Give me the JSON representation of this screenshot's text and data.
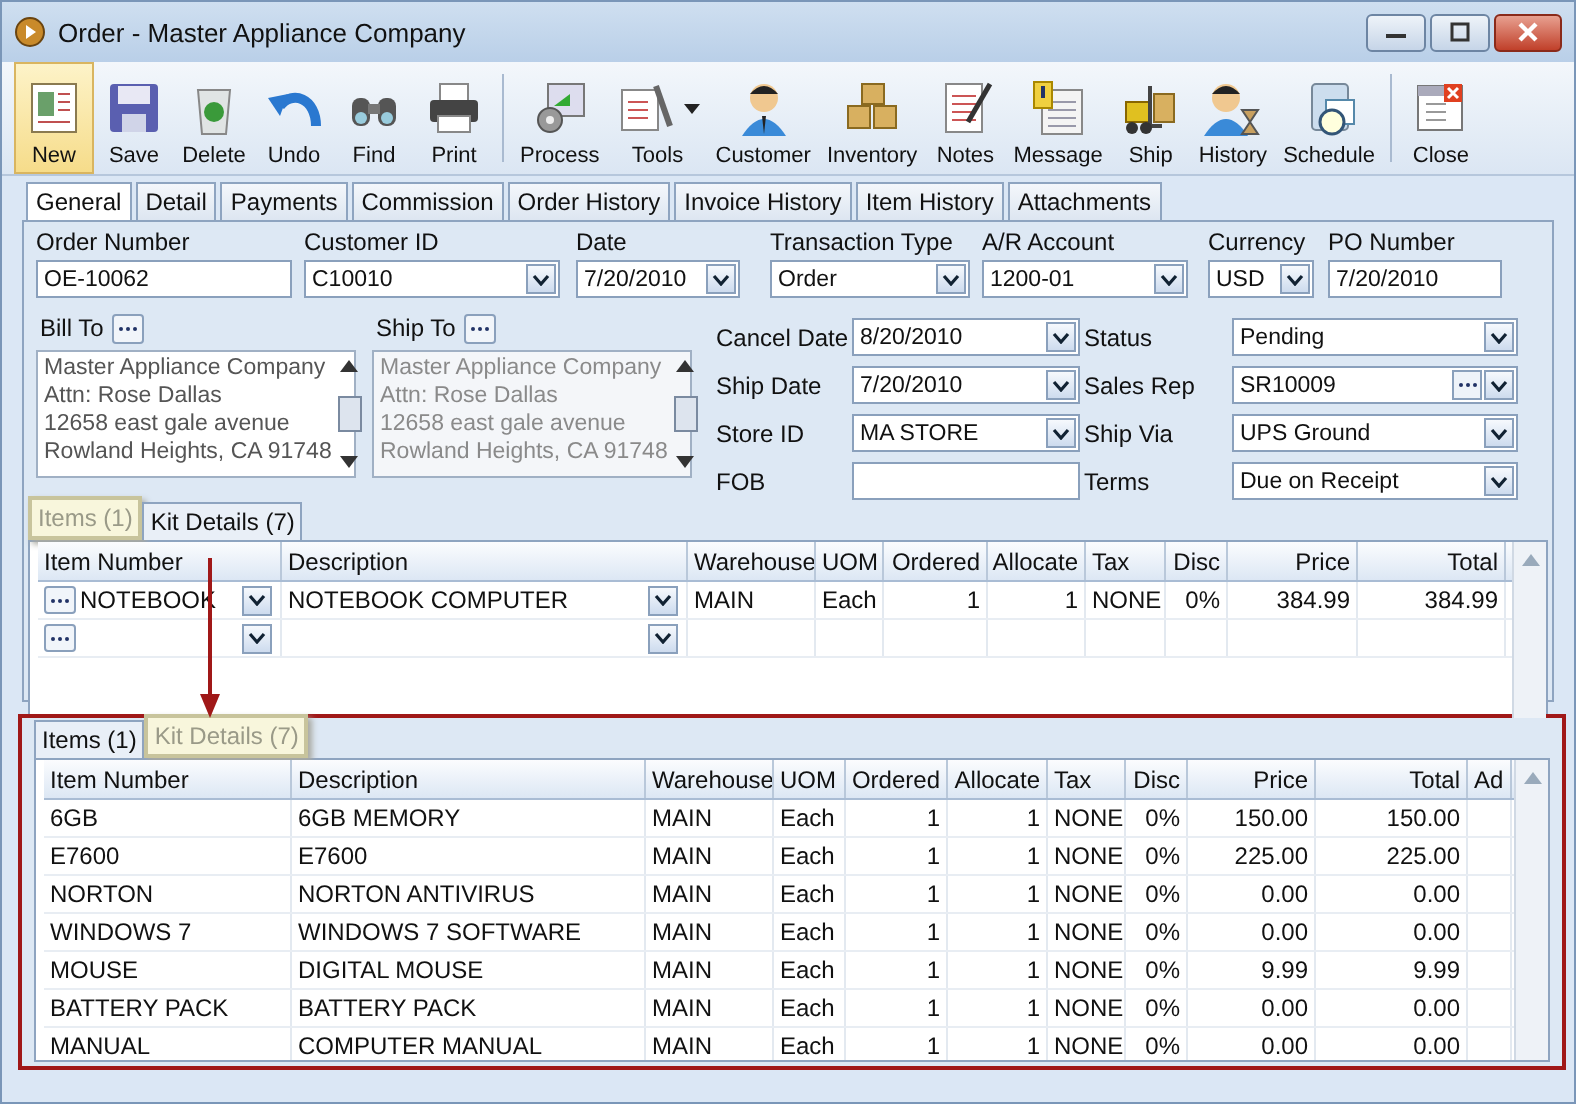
{
  "window": {
    "title": "Order - Master Appliance Company"
  },
  "toolbar_groups": [
    {
      "buttons": [
        {
          "label": "New",
          "selected": true,
          "dropdown": false
        },
        {
          "label": "Save",
          "selected": false,
          "dropdown": false
        },
        {
          "label": "Delete",
          "selected": false,
          "dropdown": false
        },
        {
          "label": "Undo",
          "selected": false,
          "dropdown": false
        },
        {
          "label": "Find",
          "selected": false,
          "dropdown": false
        },
        {
          "label": "Print",
          "selected": false,
          "dropdown": false
        }
      ]
    },
    {
      "buttons": [
        {
          "label": "Process",
          "selected": false,
          "dropdown": false
        },
        {
          "label": "Tools",
          "selected": false,
          "dropdown": true
        },
        {
          "label": "Customer",
          "selected": false,
          "dropdown": false
        },
        {
          "label": "Inventory",
          "selected": false,
          "dropdown": false
        },
        {
          "label": "Notes",
          "selected": false,
          "dropdown": false
        },
        {
          "label": "Message",
          "selected": false,
          "dropdown": false
        },
        {
          "label": "Ship",
          "selected": false,
          "dropdown": false
        },
        {
          "label": "History",
          "selected": false,
          "dropdown": false
        },
        {
          "label": "Schedule",
          "selected": false,
          "dropdown": false
        }
      ]
    },
    {
      "buttons": [
        {
          "label": "Close",
          "selected": false,
          "dropdown": false
        }
      ]
    }
  ],
  "tabs": [
    {
      "label": "General",
      "selected": true
    },
    {
      "label": "Detail",
      "selected": false
    },
    {
      "label": "Payments",
      "selected": false
    },
    {
      "label": "Commission",
      "selected": false
    },
    {
      "label": "Order History",
      "selected": false
    },
    {
      "label": "Invoice History",
      "selected": false
    },
    {
      "label": "Item History",
      "selected": false
    },
    {
      "label": "Attachments",
      "selected": false
    }
  ],
  "form": {
    "header_fields": [
      {
        "label": "Order Number",
        "value": "OE-10062",
        "kind": "text"
      },
      {
        "label": "Customer ID",
        "value": "C10010",
        "kind": "combo"
      },
      {
        "label": "Date",
        "value": "7/20/2010",
        "kind": "combo"
      },
      {
        "label": "Transaction Type",
        "value": "Order",
        "kind": "combo"
      },
      {
        "label": "A/R Account",
        "value": "1200-01",
        "kind": "combo"
      },
      {
        "label": "Currency",
        "value": "USD",
        "kind": "combo"
      },
      {
        "label": "PO Number",
        "value": "7/20/2010",
        "kind": "text"
      }
    ],
    "bill_to": {
      "label": "Bill To",
      "disabled": false,
      "lines": [
        "Master Appliance Company",
        "Attn: Rose Dallas",
        "12658 east gale avenue",
        "Rowland Heights, CA 91748"
      ]
    },
    "ship_to": {
      "label": "Ship To",
      "disabled": true,
      "lines": [
        "Master Appliance Company",
        "Attn: Rose Dallas",
        "12658 east gale avenue",
        "Rowland Heights, CA 91748"
      ]
    },
    "side_fields": [
      {
        "label": "Cancel  Date",
        "value": "8/20/2010",
        "kind": "combo"
      },
      {
        "label": "Status",
        "value": "Pending",
        "kind": "combo"
      },
      {
        "label": "Ship Date",
        "value": "7/20/2010",
        "kind": "combo"
      },
      {
        "label": "Sales Rep",
        "value": "SR10009",
        "kind": "lookup"
      },
      {
        "label": "Store ID",
        "value": "MA STORE",
        "kind": "combo"
      },
      {
        "label": "Ship Via",
        "value": "UPS Ground",
        "kind": "combo"
      },
      {
        "label": "FOB",
        "kind": "text"
      },
      {
        "label": "Terms",
        "value": "Due on Receipt",
        "kind": "combo"
      }
    ]
  },
  "items_tabs": [
    {
      "label": "Items (1)",
      "highlighted": true
    },
    {
      "label": "Kit Details (7)",
      "highlighted": false
    }
  ],
  "items_grid": {
    "columns": [
      {
        "label": "Item Number"
      },
      {
        "label": "Description"
      },
      {
        "label": "Warehouse"
      },
      {
        "label": "UOM"
      },
      {
        "label": "Ordered"
      },
      {
        "label": "Allocate"
      },
      {
        "label": "Tax"
      },
      {
        "label": "Disc"
      },
      {
        "label": "Price"
      },
      {
        "label": "Total"
      }
    ],
    "rows": [
      {
        "kind": "item",
        "cells": [
          "NOTEBOOK",
          "NOTEBOOK COMPUTER",
          "MAIN",
          "Each",
          "1",
          "1",
          "NONE",
          "0%",
          "384.99",
          "384.99"
        ]
      },
      {
        "kind": "new",
        "cells": []
      }
    ]
  },
  "callout": {
    "tabs": [
      {
        "label": "Items (1)",
        "highlighted": false
      },
      {
        "label": "Kit Details (7)",
        "highlighted": true
      }
    ],
    "grid": {
      "columns": [
        {
          "label": "Item Number"
        },
        {
          "label": "Description"
        },
        {
          "label": "Warehouse"
        },
        {
          "label": "UOM"
        },
        {
          "label": "Ordered"
        },
        {
          "label": "Allocate"
        },
        {
          "label": "Tax"
        },
        {
          "label": "Disc"
        },
        {
          "label": "Price"
        },
        {
          "label": "Total"
        },
        {
          "label": "Ad"
        }
      ],
      "rows": [
        {
          "kind": "item",
          "cells": [
            "6GB",
            "6GB MEMORY",
            "MAIN",
            "Each",
            "1",
            "1",
            "NONE",
            "0%",
            "150.00",
            "150.00"
          ]
        },
        {
          "kind": "item",
          "cells": [
            "E7600",
            "E7600",
            "MAIN",
            "Each",
            "1",
            "1",
            "NONE",
            "0%",
            "225.00",
            "225.00"
          ]
        },
        {
          "kind": "item",
          "cells": [
            "NORTON",
            "NORTON ANTIVIRUS",
            "MAIN",
            "Each",
            "1",
            "1",
            "NONE",
            "0%",
            "0.00",
            "0.00"
          ]
        },
        {
          "kind": "item",
          "cells": [
            "WINDOWS 7",
            "WINDOWS 7 SOFTWARE",
            "MAIN",
            "Each",
            "1",
            "1",
            "NONE",
            "0%",
            "0.00",
            "0.00"
          ]
        },
        {
          "kind": "item",
          "cells": [
            "MOUSE",
            "DIGITAL MOUSE",
            "MAIN",
            "Each",
            "1",
            "1",
            "NONE",
            "0%",
            "9.99",
            "9.99"
          ]
        },
        {
          "kind": "item",
          "cells": [
            "BATTERY PACK",
            "BATTERY PACK",
            "MAIN",
            "Each",
            "1",
            "1",
            "NONE",
            "0%",
            "0.00",
            "0.00"
          ]
        },
        {
          "kind": "item",
          "cells": [
            "MANUAL",
            "COMPUTER MANUAL",
            "MAIN",
            "Each",
            "1",
            "1",
            "NONE",
            "0%",
            "0.00",
            "0.00"
          ]
        }
      ]
    }
  }
}
